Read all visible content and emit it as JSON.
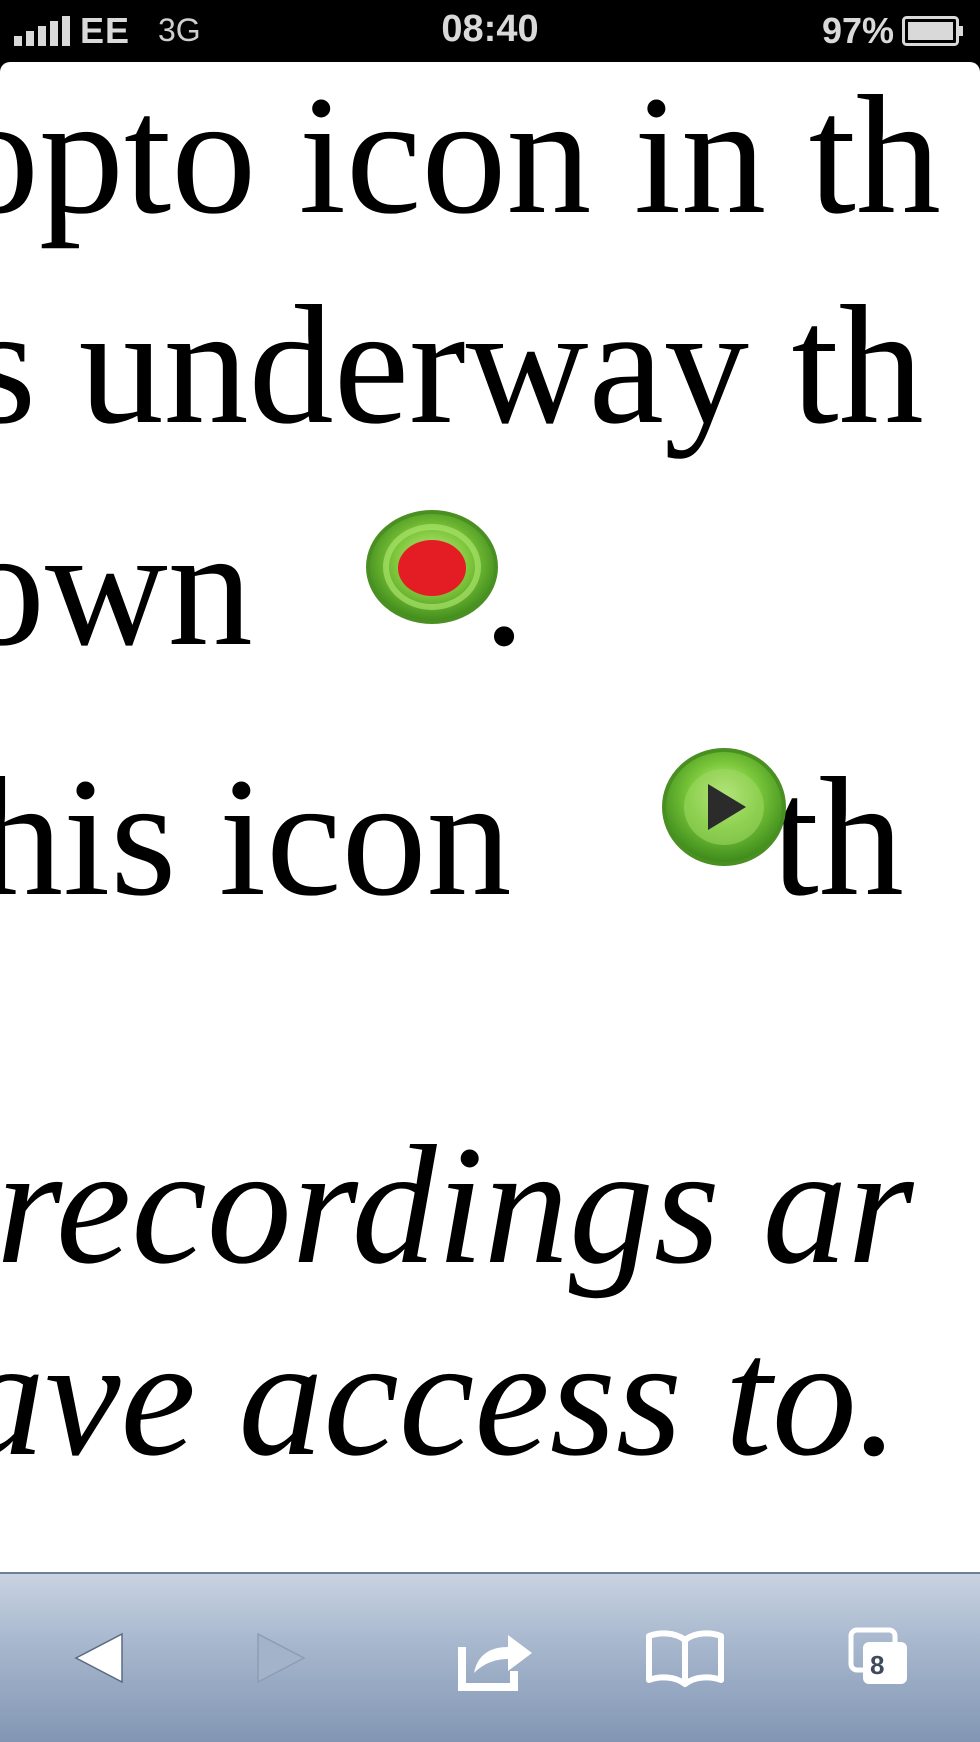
{
  "status_bar": {
    "carrier": "EE",
    "network": "3G",
    "time": "08:40",
    "battery_percent": "97%"
  },
  "article": {
    "lines": [
      "opto icon in th",
      "s underway th",
      "own",
      "his icon",
      "recordings ar",
      "ave access to."
    ],
    "line3_suffix": ".",
    "line4_suffix": "th"
  },
  "icons": {
    "record": "record-icon",
    "play": "play-icon"
  },
  "toolbar": {
    "tabs_count": "8",
    "buttons": [
      "back-icon",
      "forward-icon",
      "share-icon",
      "bookmarks-icon",
      "tabs-icon"
    ]
  },
  "colors": {
    "toolbar_top": "#c9d3e1",
    "toolbar_bottom": "#8296b4",
    "record_red": "#e41d25",
    "icon_green": "#6cbb2c"
  }
}
